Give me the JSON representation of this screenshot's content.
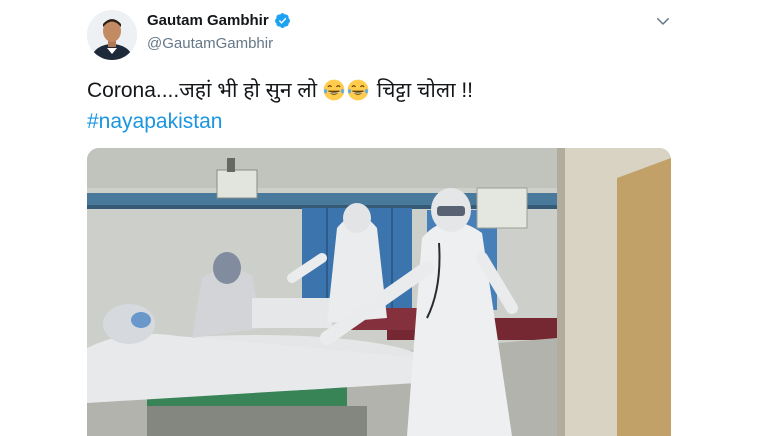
{
  "author": {
    "display_name": "Gautam Gambhir",
    "handle": "@GautamGambhir",
    "verified": true
  },
  "tweet": {
    "text_before": "Corona....जहां भी हो सुन लो",
    "emojis": [
      "face-with-tears-of-joy",
      "face-with-tears-of-joy"
    ],
    "text_after": "चिट्टा चोला !!",
    "hashtag": "#nayapakistan"
  },
  "media": {
    "type": "video-frame",
    "scene": "hospital-ward"
  },
  "colors": {
    "link": "#1b95e0",
    "verified": "#1da1f2",
    "secondary_text": "#657786",
    "primary_text": "#14171a"
  }
}
